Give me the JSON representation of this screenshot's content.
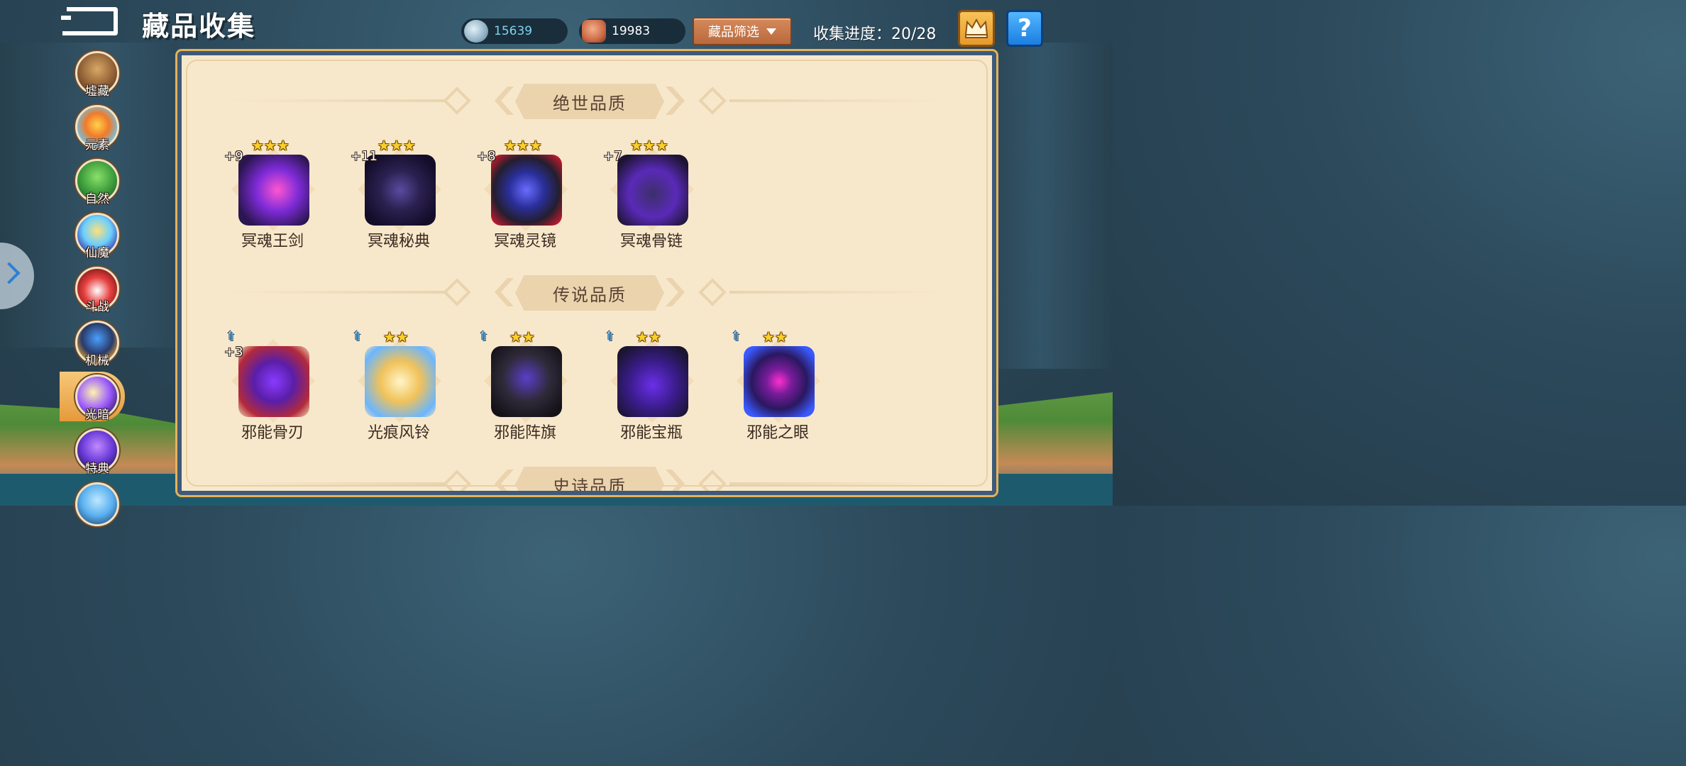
{
  "header": {
    "title": "藏品收集",
    "filter_label": "藏品筛选",
    "progress_text": "收集进度：20/28"
  },
  "currencies": [
    {
      "icon": "silver-coin-icon",
      "value": "15639",
      "color": "#7fd3f0"
    },
    {
      "icon": "red-gem-icon",
      "value": "19983",
      "color": "#ffffff"
    }
  ],
  "categories": [
    {
      "label": "墟藏",
      "icon": "chest-icon",
      "active": false
    },
    {
      "label": "元素",
      "icon": "fire-icon",
      "active": false
    },
    {
      "label": "自然",
      "icon": "tree-icon",
      "active": false
    },
    {
      "label": "仙魔",
      "icon": "crystal-icon",
      "active": false
    },
    {
      "label": "斗战",
      "icon": "cloud-orb-icon",
      "active": false
    },
    {
      "label": "机械",
      "icon": "robot-icon",
      "active": false
    },
    {
      "label": "光暗",
      "icon": "light-dark-icon",
      "active": true
    },
    {
      "label": "特典",
      "icon": "book-icon",
      "active": false
    }
  ],
  "sections": [
    {
      "title": "绝世品质",
      "items": [
        {
          "name": "冥魂王剑",
          "stars": "★★★",
          "level": "+9",
          "icon": "sword-icon",
          "upgradable": false
        },
        {
          "name": "冥魂秘典",
          "stars": "★★★",
          "level": "+11",
          "icon": "tome-icon",
          "upgradable": false
        },
        {
          "name": "冥魂灵镜",
          "stars": "★★★",
          "level": "+8",
          "icon": "mirror-icon",
          "upgradable": false
        },
        {
          "name": "冥魂骨链",
          "stars": "★★★",
          "level": "+7",
          "icon": "skull-chain-icon",
          "upgradable": false
        }
      ]
    },
    {
      "title": "传说品质",
      "items": [
        {
          "name": "邪能骨刃",
          "stars": "",
          "level": "+3",
          "icon": "bone-blade-icon",
          "upgradable": true
        },
        {
          "name": "光痕风铃",
          "stars": "★★",
          "level": "",
          "icon": "wind-bell-icon",
          "upgradable": true
        },
        {
          "name": "邪能阵旗",
          "stars": "★★",
          "level": "",
          "icon": "banner-icon",
          "upgradable": true
        },
        {
          "name": "邪能宝瓶",
          "stars": "★★",
          "level": "",
          "icon": "vase-icon",
          "upgradable": true
        },
        {
          "name": "邪能之眼",
          "stars": "★★",
          "level": "",
          "icon": "evil-eye-icon",
          "upgradable": true
        }
      ]
    },
    {
      "title": "史诗品质",
      "items": []
    }
  ],
  "help_label": "?",
  "up_arrow": "⇧"
}
